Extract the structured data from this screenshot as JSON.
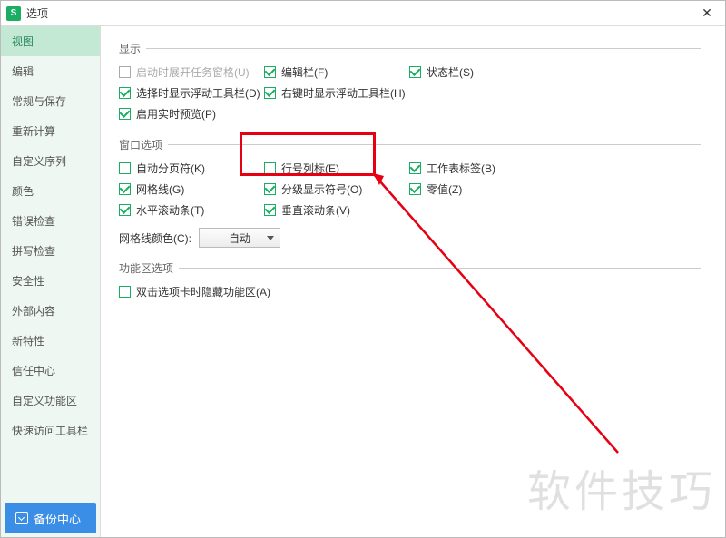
{
  "window": {
    "title": "选项"
  },
  "sidebar": {
    "items": [
      "视图",
      "编辑",
      "常规与保存",
      "重新计算",
      "自定义序列",
      "颜色",
      "错误检查",
      "拼写检查",
      "安全性",
      "外部内容",
      "新特性",
      "信任中心",
      "自定义功能区",
      "快速访问工具栏"
    ],
    "backup_label": "备份中心"
  },
  "sections": {
    "display": {
      "legend": "显示",
      "items": [
        {
          "label": "启动时展开任务窗格(U)",
          "checked": false,
          "disabled": true
        },
        {
          "label": "编辑栏(F)",
          "checked": true
        },
        {
          "label": "状态栏(S)",
          "checked": true
        },
        {
          "label": "选择时显示浮动工具栏(D)",
          "checked": true
        },
        {
          "label": "右键时显示浮动工具栏(H)",
          "checked": true
        },
        {
          "label": "启用实时预览(P)",
          "checked": true
        }
      ]
    },
    "windowopts": {
      "legend": "窗口选项",
      "items": [
        {
          "label": "自动分页符(K)",
          "checked": false
        },
        {
          "label": "行号列标(E)",
          "checked": false
        },
        {
          "label": "工作表标签(B)",
          "checked": true
        },
        {
          "label": "网格线(G)",
          "checked": true
        },
        {
          "label": "分级显示符号(O)",
          "checked": true
        },
        {
          "label": "零值(Z)",
          "checked": true
        },
        {
          "label": "水平滚动条(T)",
          "checked": true
        },
        {
          "label": "垂直滚动条(V)",
          "checked": true
        }
      ],
      "gridcolor_label": "网格线颜色(C):",
      "gridcolor_value": "自动"
    },
    "ribbon": {
      "legend": "功能区选项",
      "items": [
        {
          "label": "双击选项卡时隐藏功能区(A)",
          "checked": false
        }
      ]
    }
  },
  "watermark": "软件技巧"
}
